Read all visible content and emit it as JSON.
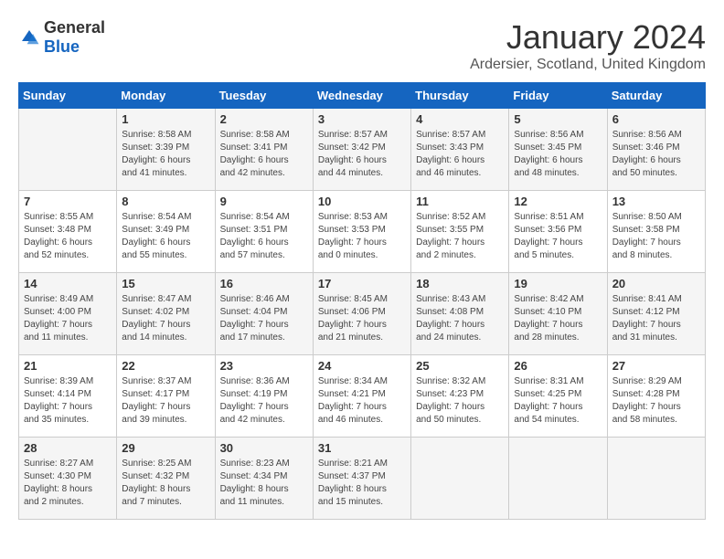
{
  "header": {
    "logo_general": "General",
    "logo_blue": "Blue",
    "month": "January 2024",
    "location": "Ardersier, Scotland, United Kingdom"
  },
  "days_of_week": [
    "Sunday",
    "Monday",
    "Tuesday",
    "Wednesday",
    "Thursday",
    "Friday",
    "Saturday"
  ],
  "weeks": [
    [
      {
        "day": "",
        "content": ""
      },
      {
        "day": "1",
        "content": "Sunrise: 8:58 AM\nSunset: 3:39 PM\nDaylight: 6 hours\nand 41 minutes."
      },
      {
        "day": "2",
        "content": "Sunrise: 8:58 AM\nSunset: 3:41 PM\nDaylight: 6 hours\nand 42 minutes."
      },
      {
        "day": "3",
        "content": "Sunrise: 8:57 AM\nSunset: 3:42 PM\nDaylight: 6 hours\nand 44 minutes."
      },
      {
        "day": "4",
        "content": "Sunrise: 8:57 AM\nSunset: 3:43 PM\nDaylight: 6 hours\nand 46 minutes."
      },
      {
        "day": "5",
        "content": "Sunrise: 8:56 AM\nSunset: 3:45 PM\nDaylight: 6 hours\nand 48 minutes."
      },
      {
        "day": "6",
        "content": "Sunrise: 8:56 AM\nSunset: 3:46 PM\nDaylight: 6 hours\nand 50 minutes."
      }
    ],
    [
      {
        "day": "7",
        "content": "Sunrise: 8:55 AM\nSunset: 3:48 PM\nDaylight: 6 hours\nand 52 minutes."
      },
      {
        "day": "8",
        "content": "Sunrise: 8:54 AM\nSunset: 3:49 PM\nDaylight: 6 hours\nand 55 minutes."
      },
      {
        "day": "9",
        "content": "Sunrise: 8:54 AM\nSunset: 3:51 PM\nDaylight: 6 hours\nand 57 minutes."
      },
      {
        "day": "10",
        "content": "Sunrise: 8:53 AM\nSunset: 3:53 PM\nDaylight: 7 hours\nand 0 minutes."
      },
      {
        "day": "11",
        "content": "Sunrise: 8:52 AM\nSunset: 3:55 PM\nDaylight: 7 hours\nand 2 minutes."
      },
      {
        "day": "12",
        "content": "Sunrise: 8:51 AM\nSunset: 3:56 PM\nDaylight: 7 hours\nand 5 minutes."
      },
      {
        "day": "13",
        "content": "Sunrise: 8:50 AM\nSunset: 3:58 PM\nDaylight: 7 hours\nand 8 minutes."
      }
    ],
    [
      {
        "day": "14",
        "content": "Sunrise: 8:49 AM\nSunset: 4:00 PM\nDaylight: 7 hours\nand 11 minutes."
      },
      {
        "day": "15",
        "content": "Sunrise: 8:47 AM\nSunset: 4:02 PM\nDaylight: 7 hours\nand 14 minutes."
      },
      {
        "day": "16",
        "content": "Sunrise: 8:46 AM\nSunset: 4:04 PM\nDaylight: 7 hours\nand 17 minutes."
      },
      {
        "day": "17",
        "content": "Sunrise: 8:45 AM\nSunset: 4:06 PM\nDaylight: 7 hours\nand 21 minutes."
      },
      {
        "day": "18",
        "content": "Sunrise: 8:43 AM\nSunset: 4:08 PM\nDaylight: 7 hours\nand 24 minutes."
      },
      {
        "day": "19",
        "content": "Sunrise: 8:42 AM\nSunset: 4:10 PM\nDaylight: 7 hours\nand 28 minutes."
      },
      {
        "day": "20",
        "content": "Sunrise: 8:41 AM\nSunset: 4:12 PM\nDaylight: 7 hours\nand 31 minutes."
      }
    ],
    [
      {
        "day": "21",
        "content": "Sunrise: 8:39 AM\nSunset: 4:14 PM\nDaylight: 7 hours\nand 35 minutes."
      },
      {
        "day": "22",
        "content": "Sunrise: 8:37 AM\nSunset: 4:17 PM\nDaylight: 7 hours\nand 39 minutes."
      },
      {
        "day": "23",
        "content": "Sunrise: 8:36 AM\nSunset: 4:19 PM\nDaylight: 7 hours\nand 42 minutes."
      },
      {
        "day": "24",
        "content": "Sunrise: 8:34 AM\nSunset: 4:21 PM\nDaylight: 7 hours\nand 46 minutes."
      },
      {
        "day": "25",
        "content": "Sunrise: 8:32 AM\nSunset: 4:23 PM\nDaylight: 7 hours\nand 50 minutes."
      },
      {
        "day": "26",
        "content": "Sunrise: 8:31 AM\nSunset: 4:25 PM\nDaylight: 7 hours\nand 54 minutes."
      },
      {
        "day": "27",
        "content": "Sunrise: 8:29 AM\nSunset: 4:28 PM\nDaylight: 7 hours\nand 58 minutes."
      }
    ],
    [
      {
        "day": "28",
        "content": "Sunrise: 8:27 AM\nSunset: 4:30 PM\nDaylight: 8 hours\nand 2 minutes."
      },
      {
        "day": "29",
        "content": "Sunrise: 8:25 AM\nSunset: 4:32 PM\nDaylight: 8 hours\nand 7 minutes."
      },
      {
        "day": "30",
        "content": "Sunrise: 8:23 AM\nSunset: 4:34 PM\nDaylight: 8 hours\nand 11 minutes."
      },
      {
        "day": "31",
        "content": "Sunrise: 8:21 AM\nSunset: 4:37 PM\nDaylight: 8 hours\nand 15 minutes."
      },
      {
        "day": "",
        "content": ""
      },
      {
        "day": "",
        "content": ""
      },
      {
        "day": "",
        "content": ""
      }
    ]
  ]
}
